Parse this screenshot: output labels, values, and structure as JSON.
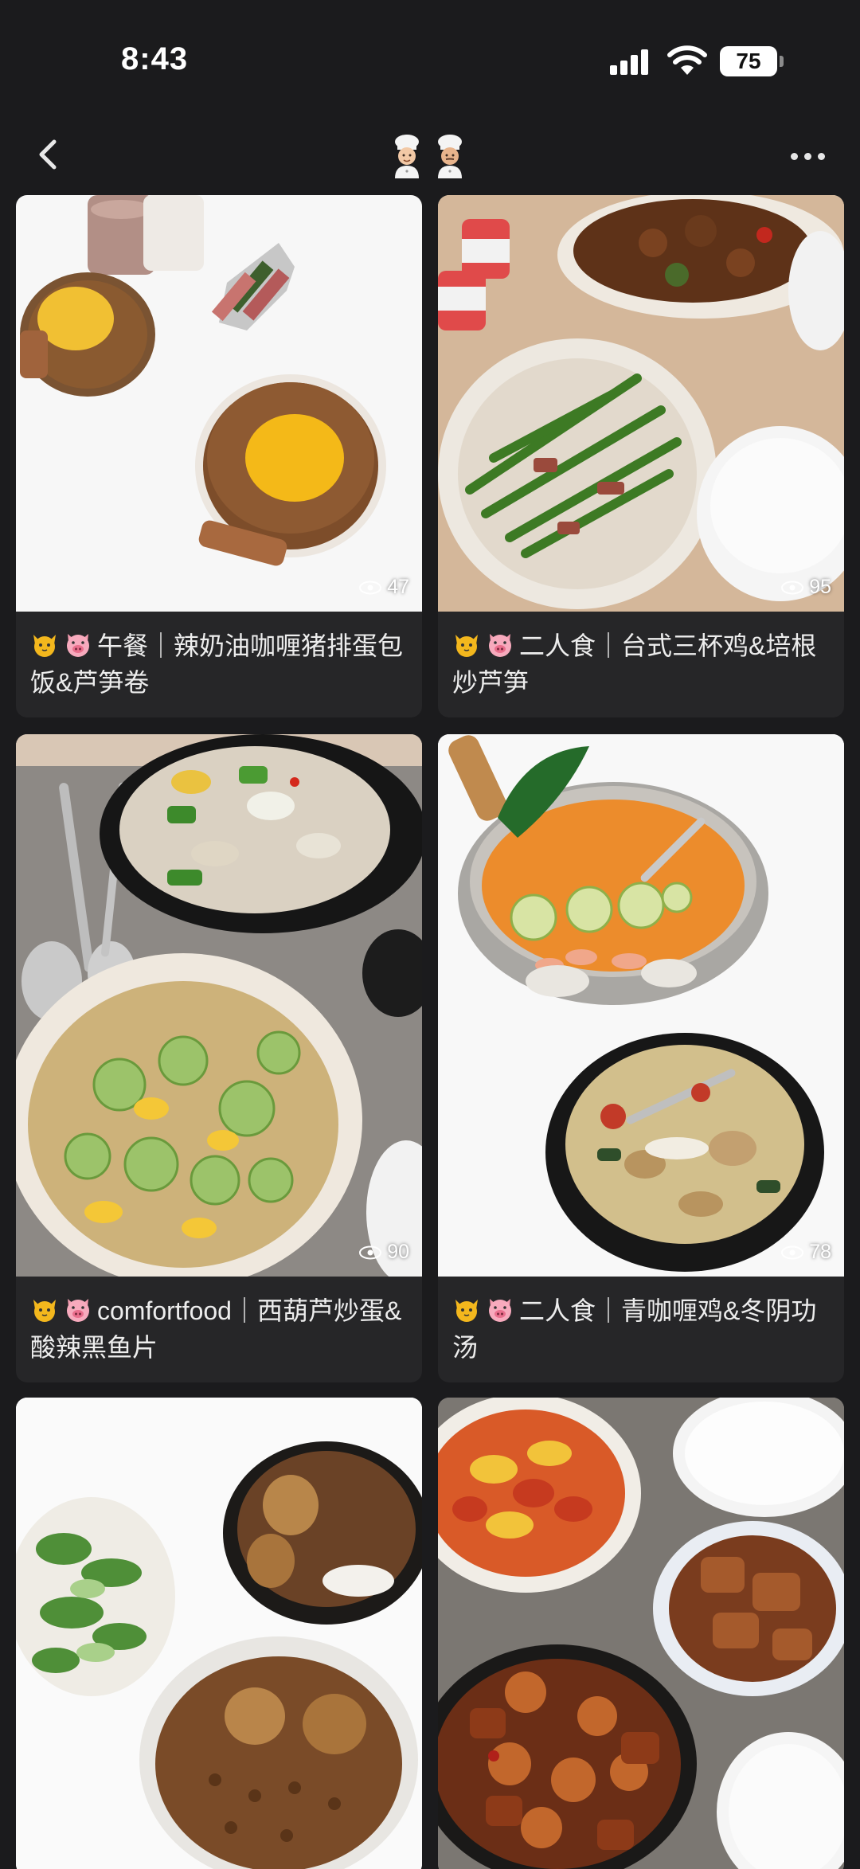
{
  "status_bar": {
    "time": "8:43",
    "battery": "75"
  },
  "nav": {
    "title_icons": [
      "cook-emoji-icon",
      "cook-emoji-icon"
    ]
  },
  "feed": {
    "posts": [
      {
        "caption": "午餐｜辣奶油咖喱猪排蛋包饭&芦笋卷",
        "views": "47"
      },
      {
        "caption": "二人食｜台式三杯鸡&培根炒芦笋",
        "views": "95"
      },
      {
        "caption": "comfortfood｜西葫芦炒蛋&酸辣黑鱼片",
        "views": "90"
      },
      {
        "caption": "二人食｜青咖喱鸡&冬阴功汤",
        "views": "78"
      },
      {
        "caption": ""
      },
      {
        "caption": ""
      }
    ]
  },
  "colors": {
    "background": "#1b1b1d",
    "card": "#262628",
    "text": "#ededed"
  }
}
